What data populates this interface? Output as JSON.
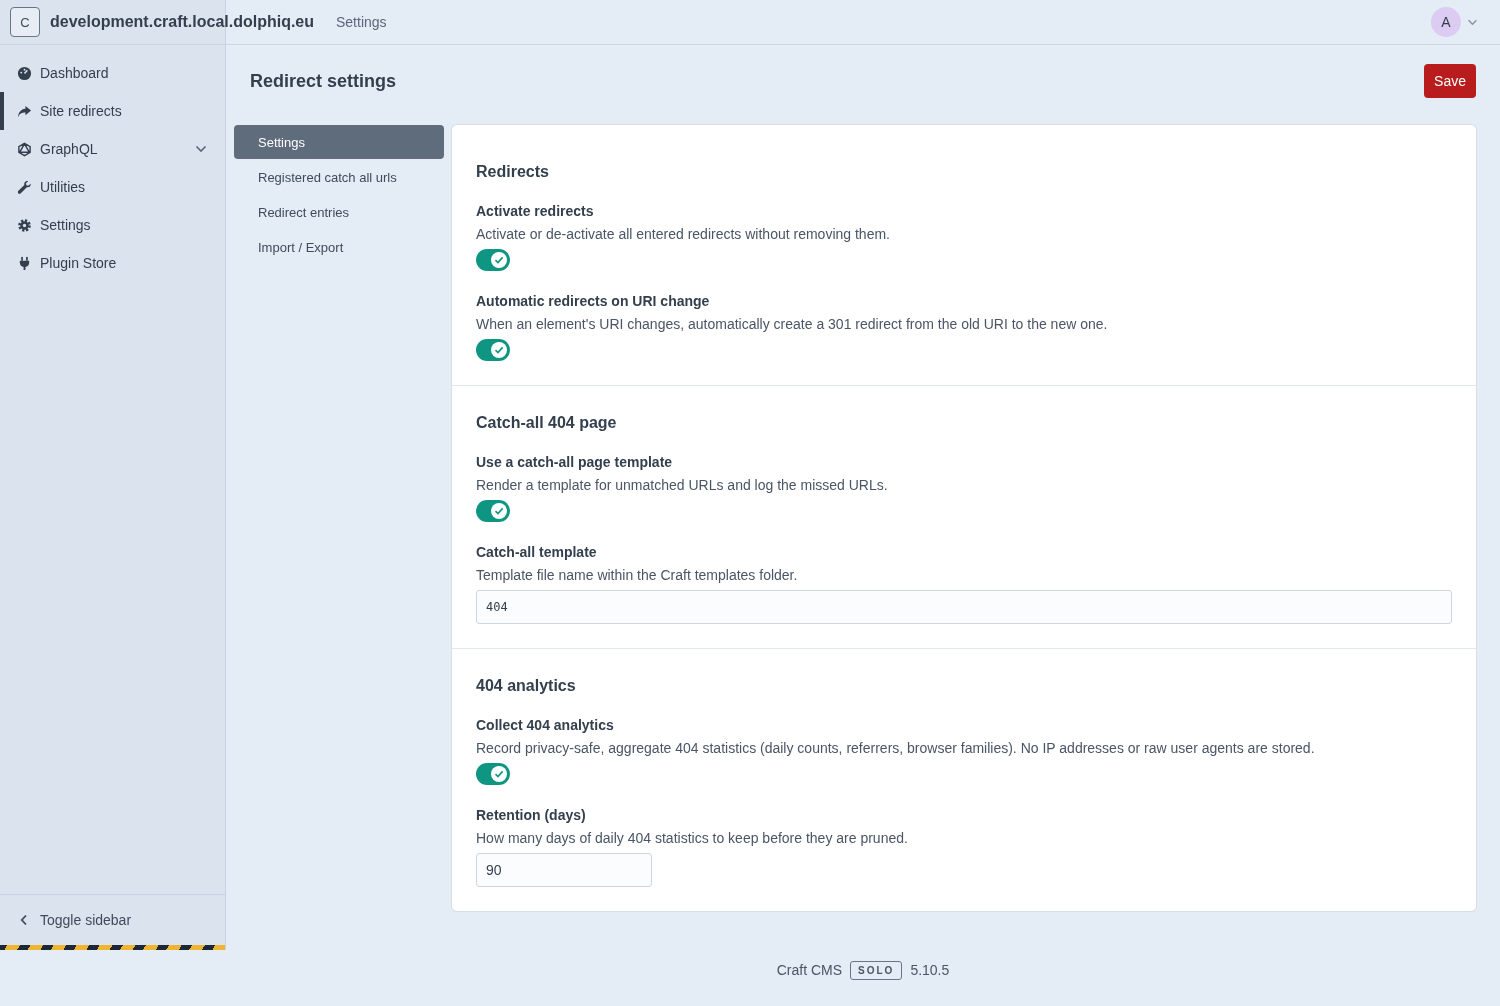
{
  "header": {
    "site_logo": "C",
    "site_name": "development.craft.local.dolphiq.eu",
    "breadcrumb": "Settings",
    "avatar": "A"
  },
  "sidebar": {
    "items": [
      {
        "label": "Dashboard",
        "kind": "link",
        "selected": false
      },
      {
        "label": "Site redirects",
        "kind": "link",
        "selected": true
      },
      {
        "label": "GraphQL",
        "kind": "group",
        "selected": false
      },
      {
        "label": "Utilities",
        "kind": "link",
        "selected": false
      },
      {
        "label": "Settings",
        "kind": "link",
        "selected": false
      },
      {
        "label": "Plugin Store",
        "kind": "link",
        "selected": false
      }
    ],
    "toggle": "Toggle sidebar"
  },
  "page": {
    "title": "Redirect settings",
    "save": "Save"
  },
  "subnav": [
    {
      "label": "Settings",
      "selected": true
    },
    {
      "label": "Registered catch all urls",
      "selected": false
    },
    {
      "label": "Redirect entries",
      "selected": false
    },
    {
      "label": "Import / Export",
      "selected": false
    }
  ],
  "sections": [
    {
      "title": "Redirects",
      "fields": [
        {
          "kind": "toggle",
          "label": "Activate redirects",
          "instructions": "Activate or de-activate all entered redirects without removing them.",
          "on": true
        },
        {
          "kind": "toggle",
          "label": "Automatic redirects on URI change",
          "instructions": "When an element's URI changes, automatically create a 301 redirect from the old URI to the new one.",
          "on": true
        }
      ]
    },
    {
      "title": "Catch-all 404 page",
      "fields": [
        {
          "kind": "toggle",
          "label": "Use a catch-all page template",
          "instructions": "Render a template for unmatched URLs and log the missed URLs.",
          "on": true
        },
        {
          "kind": "code",
          "label": "Catch-all template",
          "instructions": "Template file name within the Craft templates folder.",
          "value": "404"
        }
      ]
    },
    {
      "title": "404 analytics",
      "fields": [
        {
          "kind": "toggle",
          "label": "Collect 404 analytics",
          "instructions": "Record privacy-safe, aggregate 404 statistics (daily counts, referrers, browser families). No IP addresses or raw user agents are stored.",
          "on": true
        },
        {
          "kind": "number",
          "label": "Retention (days)",
          "instructions": "How many days of daily 404 statistics to keep before they are pruned.",
          "value": "90"
        }
      ]
    }
  ],
  "footer": {
    "product": "Craft CMS",
    "edition": "SOLO",
    "version": "5.10.5"
  }
}
